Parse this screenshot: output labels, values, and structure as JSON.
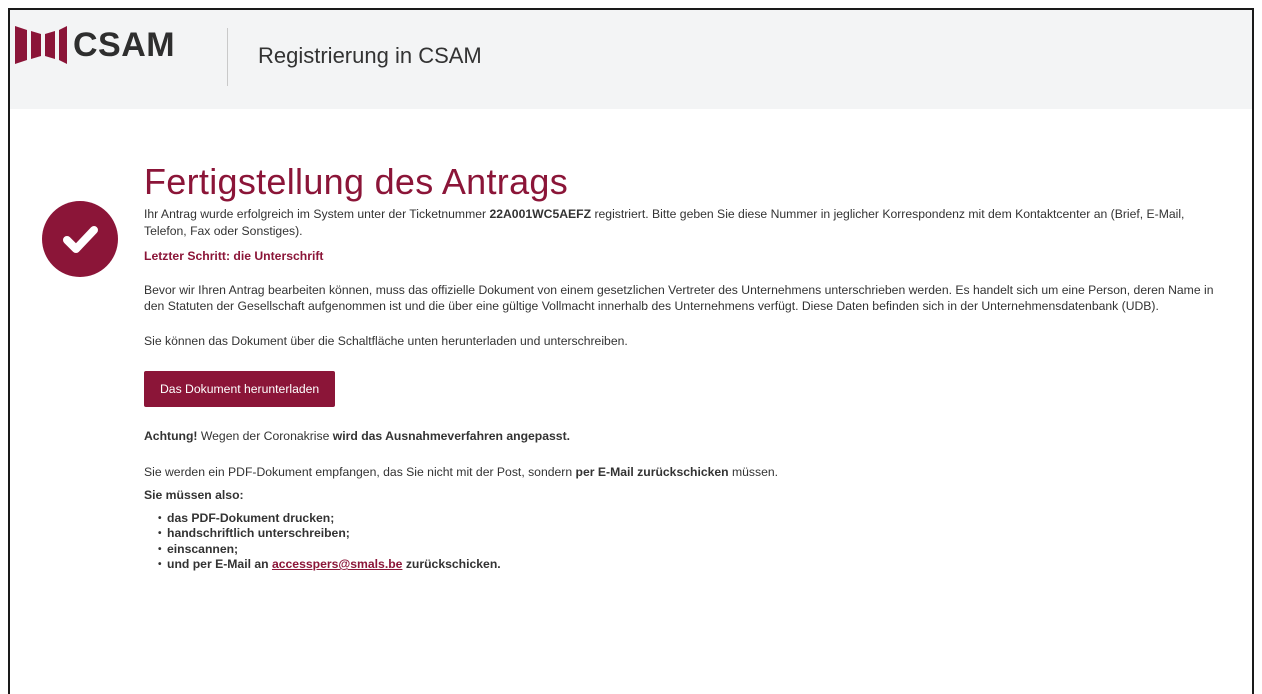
{
  "header": {
    "logo_text": "CSAM",
    "title": "Registrierung in CSAM"
  },
  "colors": {
    "brand": "#8b1538",
    "header_bg": "#f3f4f5"
  },
  "main": {
    "heading": "Fertigstellung des Antrags",
    "intro_before": "Ihr Antrag wurde erfolgreich im System unter der Ticketnummer ",
    "ticket_number": "22A001WC5AEFZ",
    "intro_after": " registriert. Bitte geben Sie diese Nummer in jeglicher Korrespondenz mit dem Kontaktcenter an (Brief, E-Mail, Telefon, Fax oder Sonstiges).",
    "step_label": "Letzter Schritt: die Unterschrift",
    "description": "Bevor wir Ihren Antrag bearbeiten können, muss das offizielle Dokument von einem gesetzlichen Vertreter des Unternehmens unterschrieben werden. Es handelt sich um eine Person, deren Name in den Statuten der Gesellschaft aufgenommen ist und die über eine gültige Vollmacht innerhalb des Unternehmens verfügt. Diese Daten befinden sich in der Unternehmensdatenbank (UDB).",
    "download_hint": "Sie können das Dokument über die Schaltfläche unten herunterladen und unterschreiben.",
    "download_button": "Das Dokument herunterladen",
    "notice_bold1": "Achtung!",
    "notice_mid": " Wegen der Coronakrise ",
    "notice_bold2": "wird das Ausnahmeverfahren angepasst.",
    "pdf_before": "Sie werden ein PDF-Dokument empfangen, das Sie nicht mit der Post, sondern ",
    "pdf_bold": "per E-Mail zurückschicken",
    "pdf_after": " müssen.",
    "must_label": "Sie müssen also:",
    "steps": [
      "das PDF-Dokument drucken;",
      "handschriftlich unterschreiben;",
      "einscannen;"
    ],
    "last_step_before": "und per E-Mail an ",
    "email": "accesspers@smals.be",
    "last_step_after": " zurückschicken."
  }
}
